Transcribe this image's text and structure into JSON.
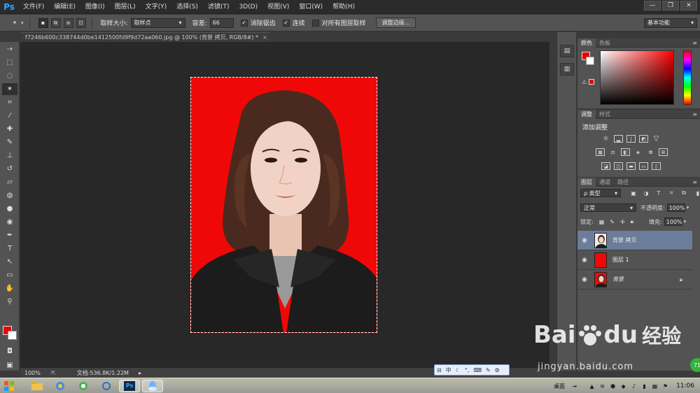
{
  "app": {
    "logo": "Ps",
    "menu": [
      "文件(F)",
      "编辑(E)",
      "图像(I)",
      "图层(L)",
      "文字(Y)",
      "选择(S)",
      "滤镜(T)",
      "3D(D)",
      "视图(V)",
      "窗口(W)",
      "帮助(H)"
    ],
    "window_controls": [
      "—",
      "❐",
      "✕"
    ]
  },
  "options": {
    "sample_size_label": "取样大小:",
    "sample_size_value": "取样点",
    "tolerance_label": "容差:",
    "tolerance_value": "66",
    "antialias_label": "消除锯齿",
    "contiguous_label": "连续",
    "sample_all_label": "对所有图层取样",
    "refine_edge_label": "调整边缘...",
    "workspace_value": "基本功能"
  },
  "document": {
    "tab_title": "f7246b600c338744d0be1412500fd9f9d72aa060.jpg @ 100% (背景 拷贝, RGB/8#) *",
    "close": "×"
  },
  "status": {
    "zoom": "100%",
    "doc_size": "文档:536.8K/1.22M"
  },
  "panels": {
    "color": {
      "tabs": [
        "颜色",
        "色板"
      ],
      "menu": "≡"
    },
    "adjustments": {
      "tabs": [
        "调整",
        "样式"
      ],
      "title": "添加调整",
      "menu": "≡"
    },
    "layers": {
      "tabs": [
        "图层",
        "通道",
        "路径"
      ],
      "menu": "≡",
      "filter_value": "ρ 类型",
      "blend_mode": "正常",
      "opacity_label": "不透明度:",
      "opacity_value": "100%",
      "lock_label": "锁定:",
      "fill_label": "填充:",
      "fill_value": "100%",
      "items": [
        {
          "name": "背景 拷贝",
          "selected": true,
          "thumb": "photo"
        },
        {
          "name": "图层 1",
          "selected": false,
          "thumb": "red"
        },
        {
          "name": "背景",
          "selected": false,
          "thumb": "photo",
          "locked": true
        }
      ]
    }
  },
  "ime": {
    "items": [
      "中",
      "☾",
      "°,",
      "⌨",
      "✎",
      "⚙"
    ]
  },
  "taskbar": {
    "desktop_label": "桌面",
    "clock": "11:06"
  },
  "watermark": {
    "brand": "Bai",
    "brand2": "du",
    "cn": "经验",
    "url": "jingyan.baidu.com"
  },
  "badge": "71",
  "colors": {
    "foreground": "#ee0000",
    "background": "#ffffff",
    "photo_background": "#f00808"
  }
}
